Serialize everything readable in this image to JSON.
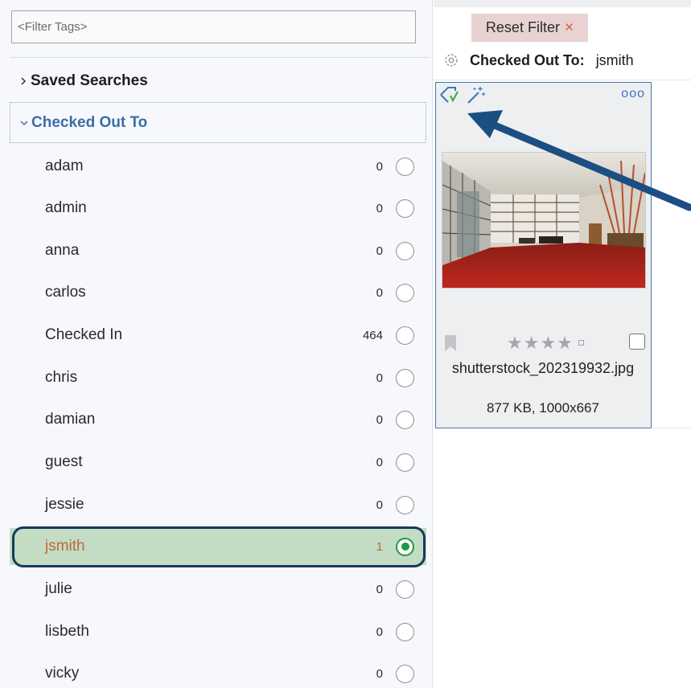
{
  "left_panel": {
    "filter_placeholder": "<Filter Tags>",
    "saved_searches_label": "Saved Searches",
    "checked_out_label": "Checked Out To",
    "users": [
      {
        "name": "adam",
        "count": "0"
      },
      {
        "name": "admin",
        "count": "0"
      },
      {
        "name": "anna",
        "count": "0"
      },
      {
        "name": "carlos",
        "count": "0"
      },
      {
        "name": "Checked In",
        "count": "464"
      },
      {
        "name": "chris",
        "count": "0"
      },
      {
        "name": "damian",
        "count": "0"
      },
      {
        "name": "guest",
        "count": "0"
      },
      {
        "name": "jessie",
        "count": "0"
      },
      {
        "name": "jsmith",
        "count": "1",
        "selected": true
      },
      {
        "name": "julie",
        "count": "0"
      },
      {
        "name": "lisbeth",
        "count": "0"
      },
      {
        "name": "vicky",
        "count": "0"
      }
    ]
  },
  "right_panel": {
    "reset_filter_label": "Reset Filter",
    "reset_filter_close": "×",
    "filter_status_label": "Checked Out To:",
    "filter_status_value": "jsmith",
    "card": {
      "more_label": "ooo",
      "stars_label": "★★★★",
      "star_rating": 4,
      "filename": "shutterstock_202319932.jpg",
      "fileinfo": "877 KB, 1000x667"
    }
  },
  "colors": {
    "accent_blue": "#3a6ea5",
    "selected_row_bg": "#c4dcc4",
    "selected_text": "#c0683a",
    "selected_radio": "#1e9a3c",
    "reset_bg": "#e9d2d2",
    "reset_x": "#e0524d",
    "card_border": "#4a78b0",
    "arrow": "#1b4e82"
  },
  "icons": [
    "chevron-right-icon",
    "chevron-down-icon",
    "gear-icon",
    "checkout-tag-icon",
    "magic-wand-icon",
    "bookmark-icon",
    "more-dots-icon",
    "close-icon"
  ]
}
